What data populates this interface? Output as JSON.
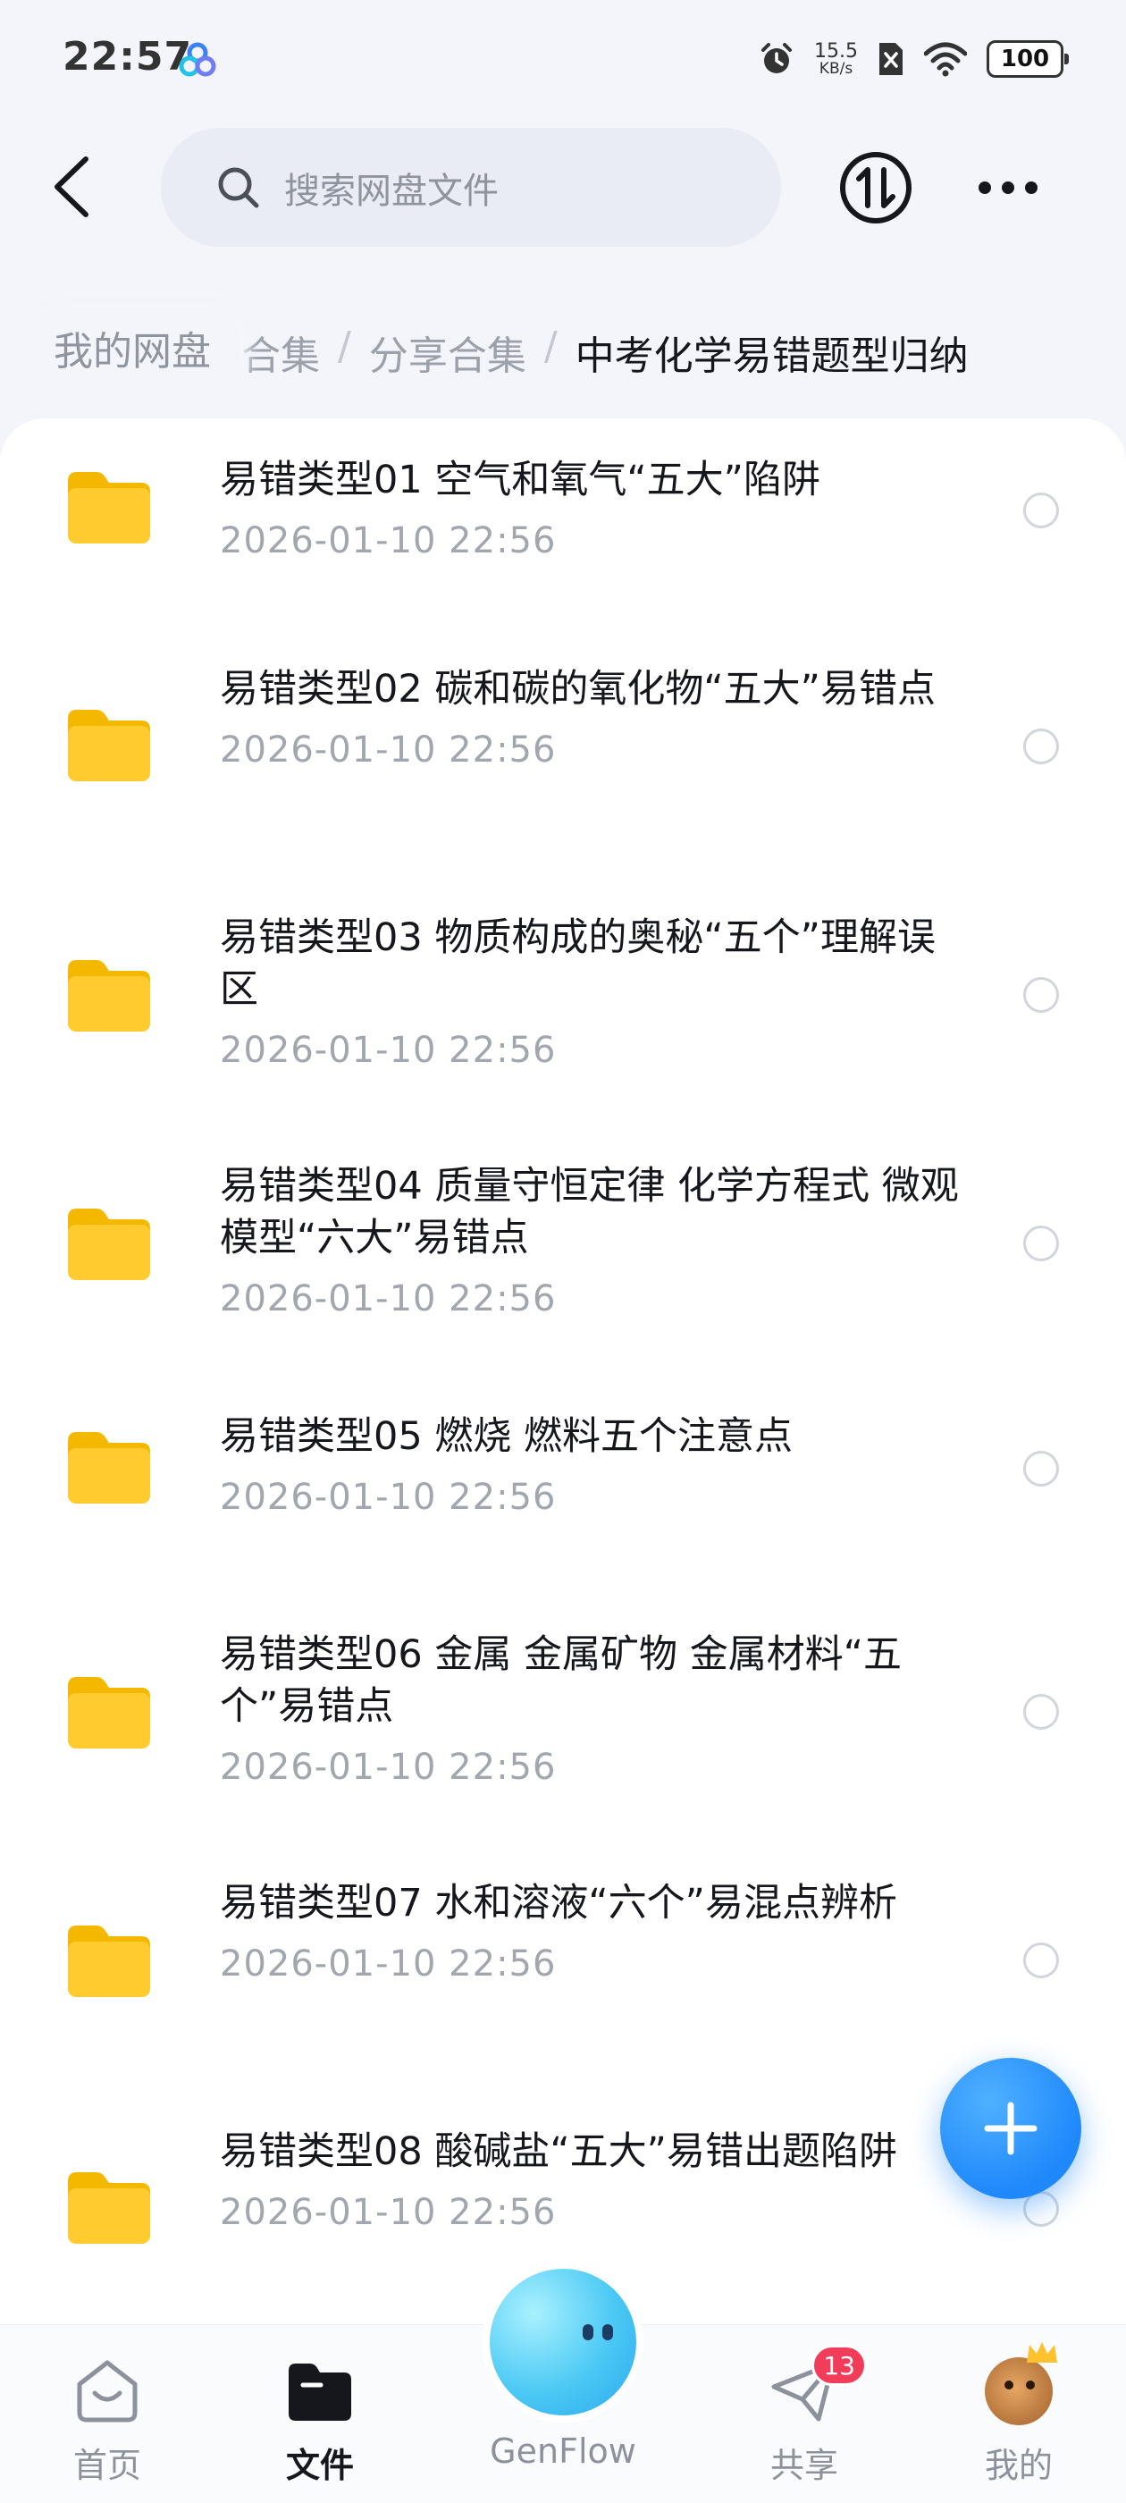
{
  "status_bar": {
    "time": "22:57",
    "net_speed_value": "15.5",
    "net_speed_unit": "KB/s",
    "battery": "100",
    "icons": [
      "baidu-netdisk-icon",
      "alarm-icon",
      "sim-off-icon",
      "wifi-icon",
      "battery-icon"
    ]
  },
  "header": {
    "back_icon": "chevron-left-icon",
    "search_placeholder": "搜索网盘文件",
    "transfer_icon": "transfer-icon",
    "more_icon": "more-icon"
  },
  "breadcrumb": {
    "root": "我的网盘",
    "trail": [
      "合集",
      "分享合集",
      "中考化学易错题型归纳"
    ]
  },
  "files": [
    {
      "name": "易错类型01 空气和氧气“五大”陷阱",
      "date": "2026-01-10  22:56"
    },
    {
      "name": "易错类型02 碳和碳的氧化物“五大”易错点",
      "date": "2026-01-10  22:56"
    },
    {
      "name": "易错类型03 物质构成的奥秘“五个”理解误区",
      "date": "2026-01-10  22:56"
    },
    {
      "name": "易错类型04 质量守恒定律 化学方程式 微观模型“六大”易错点",
      "date": "2026-01-10  22:56"
    },
    {
      "name": "易错类型05 燃烧 燃料五个注意点",
      "date": "2026-01-10  22:56"
    },
    {
      "name": "易错类型06 金属 金属矿物 金属材料“五个”易错点",
      "date": "2026-01-10  22:56"
    },
    {
      "name": "易错类型07 水和溶液“六个”易混点辨析",
      "date": "2026-01-10  22:56"
    },
    {
      "name": "易错类型08 酸碱盐“五大”易错出题陷阱",
      "date": "2026-01-10  22:56"
    }
  ],
  "fab_icon": "plus-icon",
  "bottom_nav": {
    "home": "首页",
    "files": "文件",
    "genflow": "GenFlow",
    "share": "共享",
    "share_badge": "13",
    "mine": "我的",
    "active": "files"
  },
  "colors": {
    "accent": "#1f88fb",
    "folder": "#ffcb2e",
    "badge": "#f13d5a"
  }
}
